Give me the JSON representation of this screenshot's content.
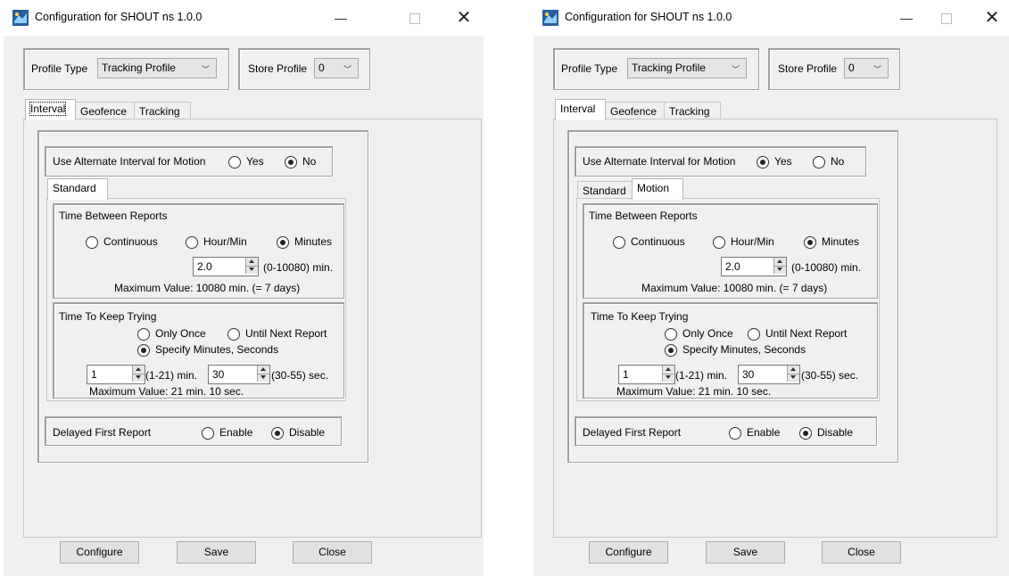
{
  "windows": [
    {
      "title": "Configuration for SHOUT ns 1.0.0",
      "profile_type": {
        "label": "Profile Type",
        "value": "Tracking Profile"
      },
      "store_profile": {
        "label": "Store Profile",
        "value": "0"
      },
      "tabs": [
        "Interval",
        "Geofence",
        "Tracking"
      ],
      "selected_tab": "Interval",
      "alt_motion": {
        "label": "Use Alternate Interval for Motion",
        "yes": "Yes",
        "no": "No",
        "selected": "No"
      },
      "subtabs": [
        "Standard"
      ],
      "time_between": {
        "title": "Time Between Reports",
        "options": [
          "Continuous",
          "Hour/Min",
          "Minutes"
        ],
        "selected": "Minutes",
        "value": "2.0",
        "range": "(0-10080) min.",
        "max_note": "Maximum Value: 10080 min. (= 7 days)"
      },
      "keep_trying": {
        "title": "Time To Keep Trying",
        "opt_once": "Only Once",
        "opt_until": "Until Next Report",
        "opt_specify": "Specify Minutes, Seconds",
        "selected": "Specify Minutes, Seconds",
        "min_value": "1",
        "min_range": "(1-21) min.",
        "sec_value": "30",
        "sec_range": "(30-55) sec.",
        "max_note": "Maximum Value:  21 min. 10 sec."
      },
      "delayed": {
        "label": "Delayed First Report",
        "enable": "Enable",
        "disable": "Disable",
        "selected": "Disable"
      },
      "buttons": {
        "configure": "Configure",
        "save": "Save",
        "close": "Close"
      }
    },
    {
      "title": "Configuration for SHOUT ns 1.0.0",
      "profile_type": {
        "label": "Profile Type",
        "value": "Tracking Profile"
      },
      "store_profile": {
        "label": "Store Profile",
        "value": "0"
      },
      "tabs": [
        "Interval",
        "Geofence",
        "Tracking"
      ],
      "selected_tab": "Interval",
      "alt_motion": {
        "label": "Use Alternate Interval for Motion",
        "yes": "Yes",
        "no": "No",
        "selected": "Yes"
      },
      "subtabs": [
        "Standard",
        "Motion"
      ],
      "time_between": {
        "title": "Time Between Reports",
        "options": [
          "Continuous",
          "Hour/Min",
          "Minutes"
        ],
        "selected": "Minutes",
        "value": "2.0",
        "range": "(0-10080) min.",
        "max_note": "Maximum Value: 10080 min. (= 7 days)"
      },
      "keep_trying": {
        "title": "Time To Keep Trying",
        "opt_once": "Only Once",
        "opt_until": "Until Next Report",
        "opt_specify": "Specify Minutes, Seconds",
        "selected": "Specify Minutes, Seconds",
        "min_value": "1",
        "min_range": "(1-21) min.",
        "sec_value": "30",
        "sec_range": "(30-55) sec.",
        "max_note": "Maximum Value:  21 min. 10 sec."
      },
      "delayed": {
        "label": "Delayed First Report",
        "enable": "Enable",
        "disable": "Disable",
        "selected": "Disable"
      },
      "buttons": {
        "configure": "Configure",
        "save": "Save",
        "close": "Close"
      }
    }
  ]
}
